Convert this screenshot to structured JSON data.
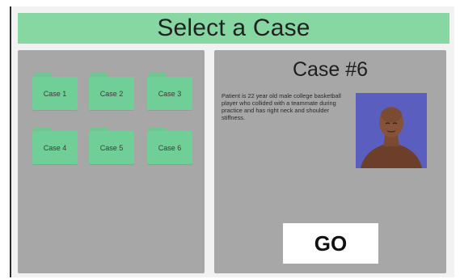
{
  "header": {
    "title": "Select a Case"
  },
  "cases": [
    {
      "label": "Case 1"
    },
    {
      "label": "Case 2"
    },
    {
      "label": "Case 3"
    },
    {
      "label": "Case 4"
    },
    {
      "label": "Case 5"
    },
    {
      "label": "Case 6"
    }
  ],
  "detail": {
    "title": "Case #6",
    "description": "Patient is 22 year old male college basketball player who collided with a teammate during practice and has right neck and shoulder stiffness.",
    "photo_icon": "patient-photo",
    "go_label": "GO"
  },
  "colors": {
    "title_bar": "#87d7a3",
    "folder": "#6fcf97",
    "panel": "#a7a7a7",
    "photo_background": "#5a5fbf"
  }
}
